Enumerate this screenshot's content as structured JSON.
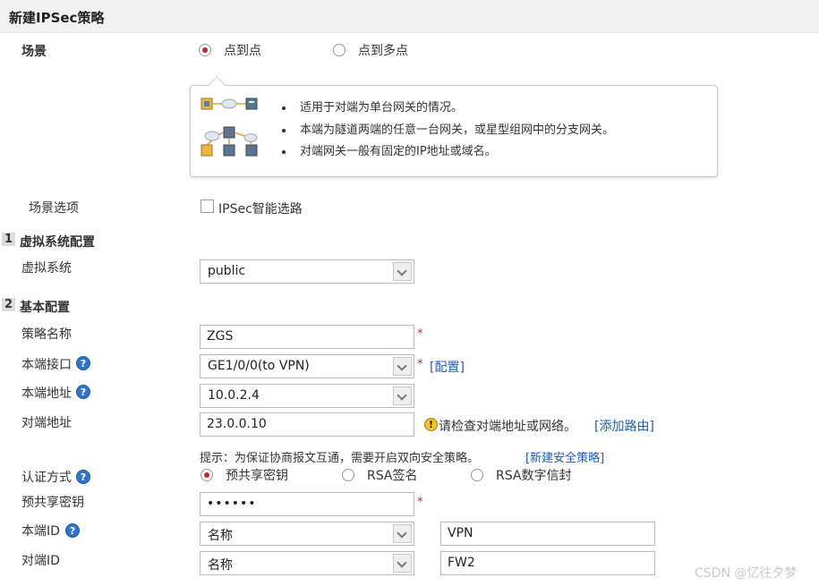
{
  "title": "新建IPSec策略",
  "scene": {
    "label": "场景",
    "options": [
      "点到点",
      "点到多点"
    ],
    "selected": "点到点"
  },
  "info_bullets": [
    "适用于对端为单台网关的情况。",
    "本端为隧道两端的任意一台网关，或星型组网中的分支网关。",
    "对端网关一般有固定的IP地址或域名。"
  ],
  "scene_options": {
    "label": "场景选项",
    "checkbox_label": "IPSec智能选路",
    "checked": false
  },
  "section1": {
    "num": "1",
    "title": "虚拟系统配置"
  },
  "vsys": {
    "label": "虚拟系统",
    "value": "public"
  },
  "section2": {
    "num": "2",
    "title": "基本配置"
  },
  "policy_name": {
    "label": "策略名称",
    "value": "ZGS"
  },
  "local_interface": {
    "label": "本端接口",
    "value": "GE1/0/0(to VPN)",
    "link": "[配置]"
  },
  "local_address": {
    "label": "本端地址",
    "value": "10.0.2.4"
  },
  "peer_address": {
    "label": "对端地址",
    "value": "23.0.0.10",
    "warning": "请检查对端地址或网络。",
    "link": "[添加路由]"
  },
  "hint": {
    "text": "提示：为保证协商报文互通，需要开启双向安全策略。",
    "link": "[新建安全策略]"
  },
  "auth": {
    "label": "认证方式",
    "options": [
      "预共享密钥",
      "RSA签名",
      "RSA数字信封"
    ],
    "selected": "预共享密钥"
  },
  "psk": {
    "label": "预共享密钥",
    "value": "••••••"
  },
  "local_id": {
    "label": "本端ID",
    "type": "名称",
    "value": "VPN"
  },
  "peer_id": {
    "label": "对端ID",
    "type": "名称",
    "value": "FW2"
  },
  "required_mark": "*",
  "help_glyph": "?",
  "warn_glyph": "!",
  "watermark": "CSDN @忆往夕梦",
  "colors": {
    "accent_red": "#c0282d",
    "link_blue": "#1b5cb8",
    "help_blue": "#2f74c8"
  }
}
